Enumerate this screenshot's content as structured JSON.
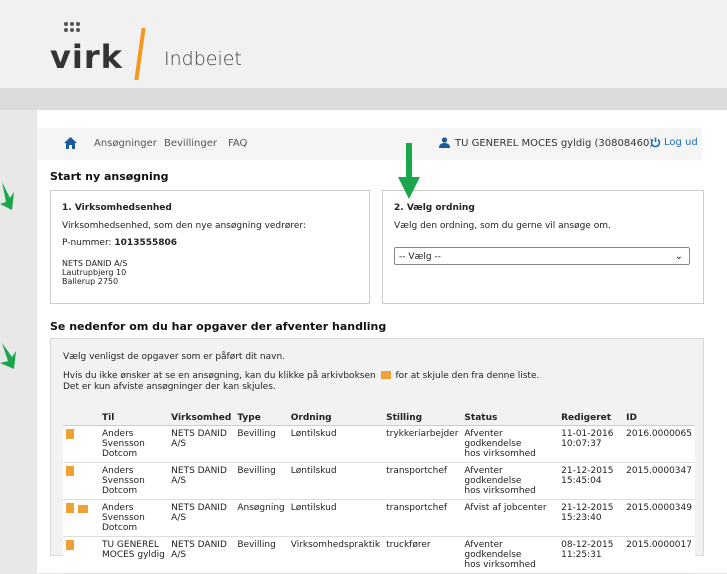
{
  "header": {
    "logo": "virk",
    "product": "Indbeiet"
  },
  "nav": {
    "items": [
      "Ansøgninger",
      "Bevillinger",
      "FAQ"
    ],
    "user": "TU GENEREL MOCES gyldig (30808460)",
    "logout": "Log ud"
  },
  "start": {
    "heading": "Start ny ansøgning",
    "box1": {
      "title": "1. Virksomhedsenhed",
      "desc": "Virksomhedsenhed, som den nye ansøgning vedrører:",
      "pnr_label": "P-nummer: ",
      "pnr": "1013555806",
      "addr": [
        "NETS DANID A/S",
        "Lautrupbjerg 10",
        "Ballerup 2750"
      ]
    },
    "box2": {
      "title": "2. Vælg ordning",
      "desc": "Vælg den ordning, som du gerne vil ansøge om.",
      "select": "-- Vælg --"
    }
  },
  "tasks": {
    "heading": "Se nedenfor om du har opgaver der afventer handling",
    "intro": "Vælg venligst de opgaver som er påført dit navn.",
    "hint1": "Hvis du ikke ønsker at se en ansøgning, kan du klikke på arkivboksen",
    "hint2": "for at skjule den fra denne liste.",
    "hint3": "Det er kun afviste ansøgninger der kan skjules.",
    "columns": [
      "Til",
      "Virksomhed",
      "Type",
      "Ordning",
      "Stilling",
      "Status",
      "Redigeret",
      "ID"
    ],
    "rows": [
      {
        "archive": false,
        "til": [
          "Anders Svensson",
          "Dotcom"
        ],
        "virk": [
          "NETS DANID",
          "A/S"
        ],
        "type": "Bevilling",
        "ordning": "Løntilskud",
        "stilling": "trykkeriarbejder",
        "status": [
          "Afventer godkendelse",
          "hos virksomhed"
        ],
        "red": [
          "11-01-2016",
          "10:07:37"
        ],
        "id": "2016.0000065"
      },
      {
        "archive": false,
        "til": [
          "Anders Svensson",
          "Dotcom"
        ],
        "virk": [
          "NETS DANID",
          "A/S"
        ],
        "type": "Bevilling",
        "ordning": "Løntilskud",
        "stilling": "transportchef",
        "status": [
          "Afventer godkendelse",
          "hos virksomhed"
        ],
        "red": [
          "21-12-2015",
          "15:45:04"
        ],
        "id": "2015.0000347"
      },
      {
        "archive": true,
        "til": [
          "Anders Svensson",
          "Dotcom"
        ],
        "virk": [
          "NETS DANID",
          "A/S"
        ],
        "type": "Ansøgning",
        "ordning": "Løntilskud",
        "stilling": "transportchef",
        "status": [
          "Afvist af jobcenter",
          ""
        ],
        "red": [
          "21-12-2015",
          "15:23:40"
        ],
        "id": "2015.0000349"
      },
      {
        "archive": false,
        "til": [
          "TU GENEREL",
          "MOCES gyldig"
        ],
        "virk": [
          "NETS DANID",
          "A/S"
        ],
        "type": "Bevilling",
        "ordning": "Virksomhedspraktik",
        "stilling": "truckfører",
        "status": [
          "Afventer godkendelse",
          "hos virksomhed"
        ],
        "red": [
          "08-12-2015",
          "11:25:31"
        ],
        "id": "2015.0000017"
      }
    ]
  },
  "colors": {
    "accent": "#f39a1e",
    "link": "#1a6ec1",
    "arrow": "#1aa64a"
  }
}
